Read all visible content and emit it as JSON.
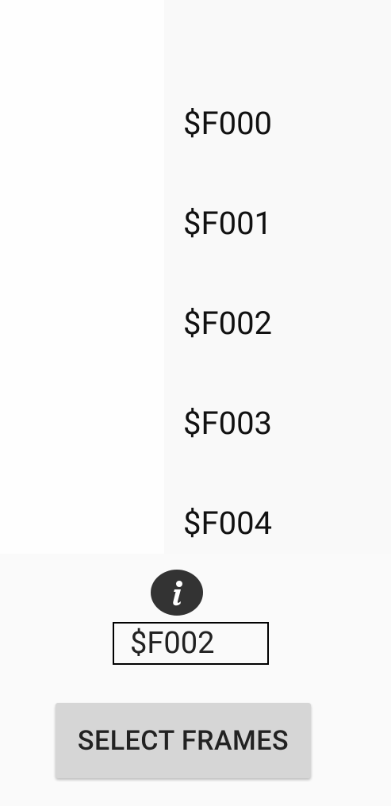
{
  "frames": [
    {
      "label": "$F000"
    },
    {
      "label": "$F001"
    },
    {
      "label": "$F002"
    },
    {
      "label": "$F003"
    },
    {
      "label": "$F004"
    }
  ],
  "selected_frame": "$F002",
  "select_button_label": "SELECT FRAMES",
  "info_icon": "info-icon"
}
